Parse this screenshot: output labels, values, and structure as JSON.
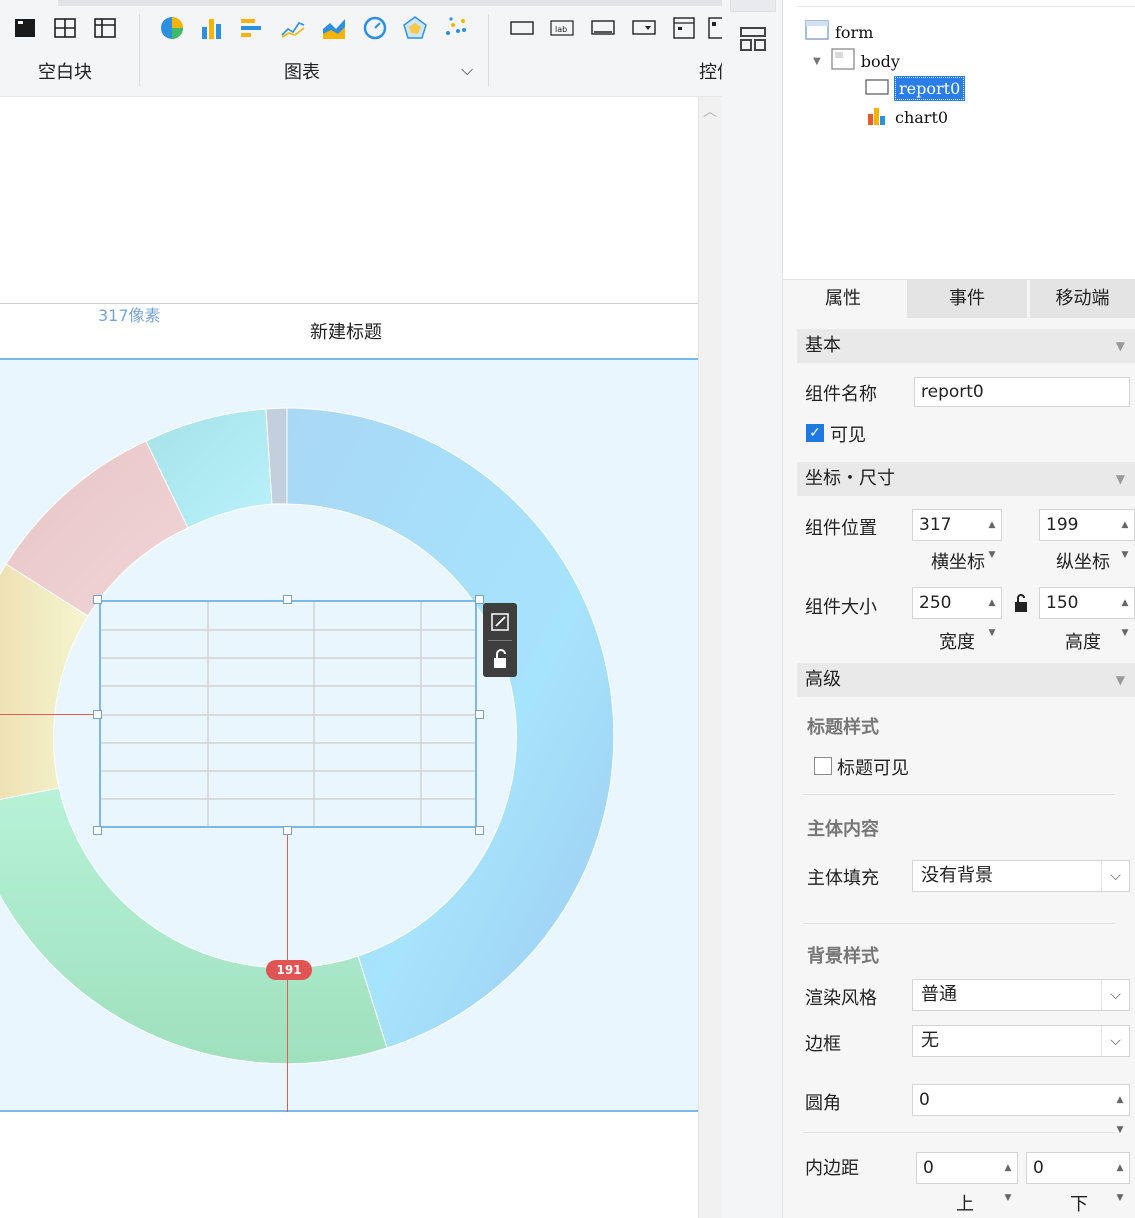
{
  "toolbar": {
    "groups": [
      {
        "label": "空白块"
      },
      {
        "label": "图表"
      },
      {
        "label": "控件"
      }
    ],
    "blank_icons": [
      "panel-icon",
      "split-layout-icon",
      "grid-layout-icon"
    ],
    "chart_icons": [
      "pie-chart-icon",
      "bar-chart-icon",
      "horizontal-bar-icon",
      "line-chart-icon",
      "area-chart-icon",
      "gauge-chart-icon",
      "radar-chart-icon",
      "scatter-chart-icon"
    ],
    "control_icons": [
      "textbox-icon",
      "label-icon",
      "button-icon",
      "dropdown-icon",
      "date-picker-icon",
      "calendar-icon"
    ]
  },
  "canvas": {
    "pixel_hint": "317像素",
    "widget_title": "新建标题",
    "guide_badge": "191"
  },
  "tree": {
    "nodes": [
      {
        "label": "form"
      },
      {
        "label": "body"
      },
      {
        "label": "report0",
        "selected": true
      },
      {
        "label": "chart0"
      }
    ]
  },
  "props": {
    "tabs": [
      "属性",
      "事件",
      "移动端"
    ],
    "basic": {
      "title": "基本",
      "name_label": "组件名称",
      "name_value": "report0",
      "visible_label": "可见",
      "visible": true
    },
    "geometry": {
      "title": "坐标・尺寸",
      "position_label": "组件位置",
      "x_value": "317",
      "y_value": "199",
      "x_caption": "横坐标",
      "y_caption": "纵坐标",
      "size_label": "组件大小",
      "w_value": "250",
      "h_value": "150",
      "w_caption": "宽度",
      "h_caption": "高度"
    },
    "advanced": {
      "title": "高级",
      "title_style_label": "标题样式",
      "title_visible_label": "标题可见",
      "title_visible": false,
      "body_content_label": "主体内容",
      "body_fill_label": "主体填充",
      "body_fill_value": "没有背景",
      "bg_style_label": "背景样式",
      "render_label": "渲染风格",
      "render_value": "普通",
      "border_label": "边框",
      "border_value": "无",
      "radius_label": "圆角",
      "radius_value": "0",
      "padding_label": "内边距",
      "padding_top": "0",
      "padding_bottom": "0",
      "top_caption": "上",
      "bottom_caption": "下"
    }
  },
  "colors": {
    "accent": "#2b7de9",
    "chart_bg": "#eaf6fd",
    "guide": "#e35a5a"
  }
}
